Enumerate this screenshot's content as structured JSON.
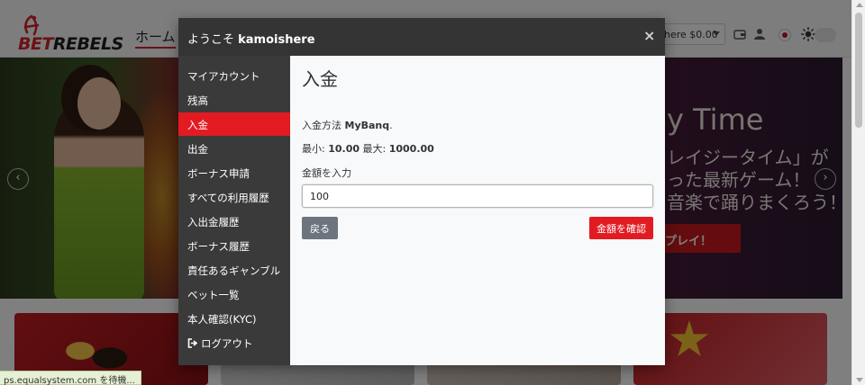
{
  "brand": {
    "bet": "BET",
    "rebels": "REBELS",
    "color": "#d7232b"
  },
  "header": {
    "nav_home": "ホーム",
    "balance": "here $0.00"
  },
  "hero": {
    "title_en": "y Time",
    "line1": "レイジータイム」が",
    "line2": "った最新ゲーム！",
    "line3": "音楽で踊りまくろう！",
    "cta": "プレイ！"
  },
  "modal": {
    "title_prefix": "ようこそ ",
    "username": "kamoishere",
    "close_symbol": "×",
    "menu": [
      {
        "label": "マイアカウント"
      },
      {
        "label": "残高"
      },
      {
        "label": "入金"
      },
      {
        "label": "出金"
      },
      {
        "label": "ボーナス申請"
      },
      {
        "label": "すべての利用履歴"
      },
      {
        "label": "入出金履歴"
      },
      {
        "label": "ボーナス履歴"
      },
      {
        "label": "責任あるギャンブル"
      },
      {
        "label": "ベット一覧"
      },
      {
        "label": "本人確認(KYC)"
      },
      {
        "label": "ログアウト"
      }
    ],
    "active_item": "入金",
    "content": {
      "title": "入金",
      "method_prefix": "入金方法 ",
      "method_name": "MyBanq",
      "method_suffix": ".",
      "min_label": "最小: ",
      "min_value": "10.00",
      "max_label": " 最大: ",
      "max_value": "1000.00",
      "amount_label": "金額を入力",
      "amount_value": "100",
      "back_label": "戻る",
      "confirm_label": "金額を確認"
    },
    "accent_color": "#e21b23"
  },
  "status_bar": {
    "text": "ps.equalsystem.com を待機..."
  },
  "icons": [
    "wallet-icon",
    "user-icon",
    "flag-icon",
    "sun-icon",
    "close-icon",
    "logout-icon",
    "chevron-left-icon",
    "chevron-right-icon"
  ]
}
